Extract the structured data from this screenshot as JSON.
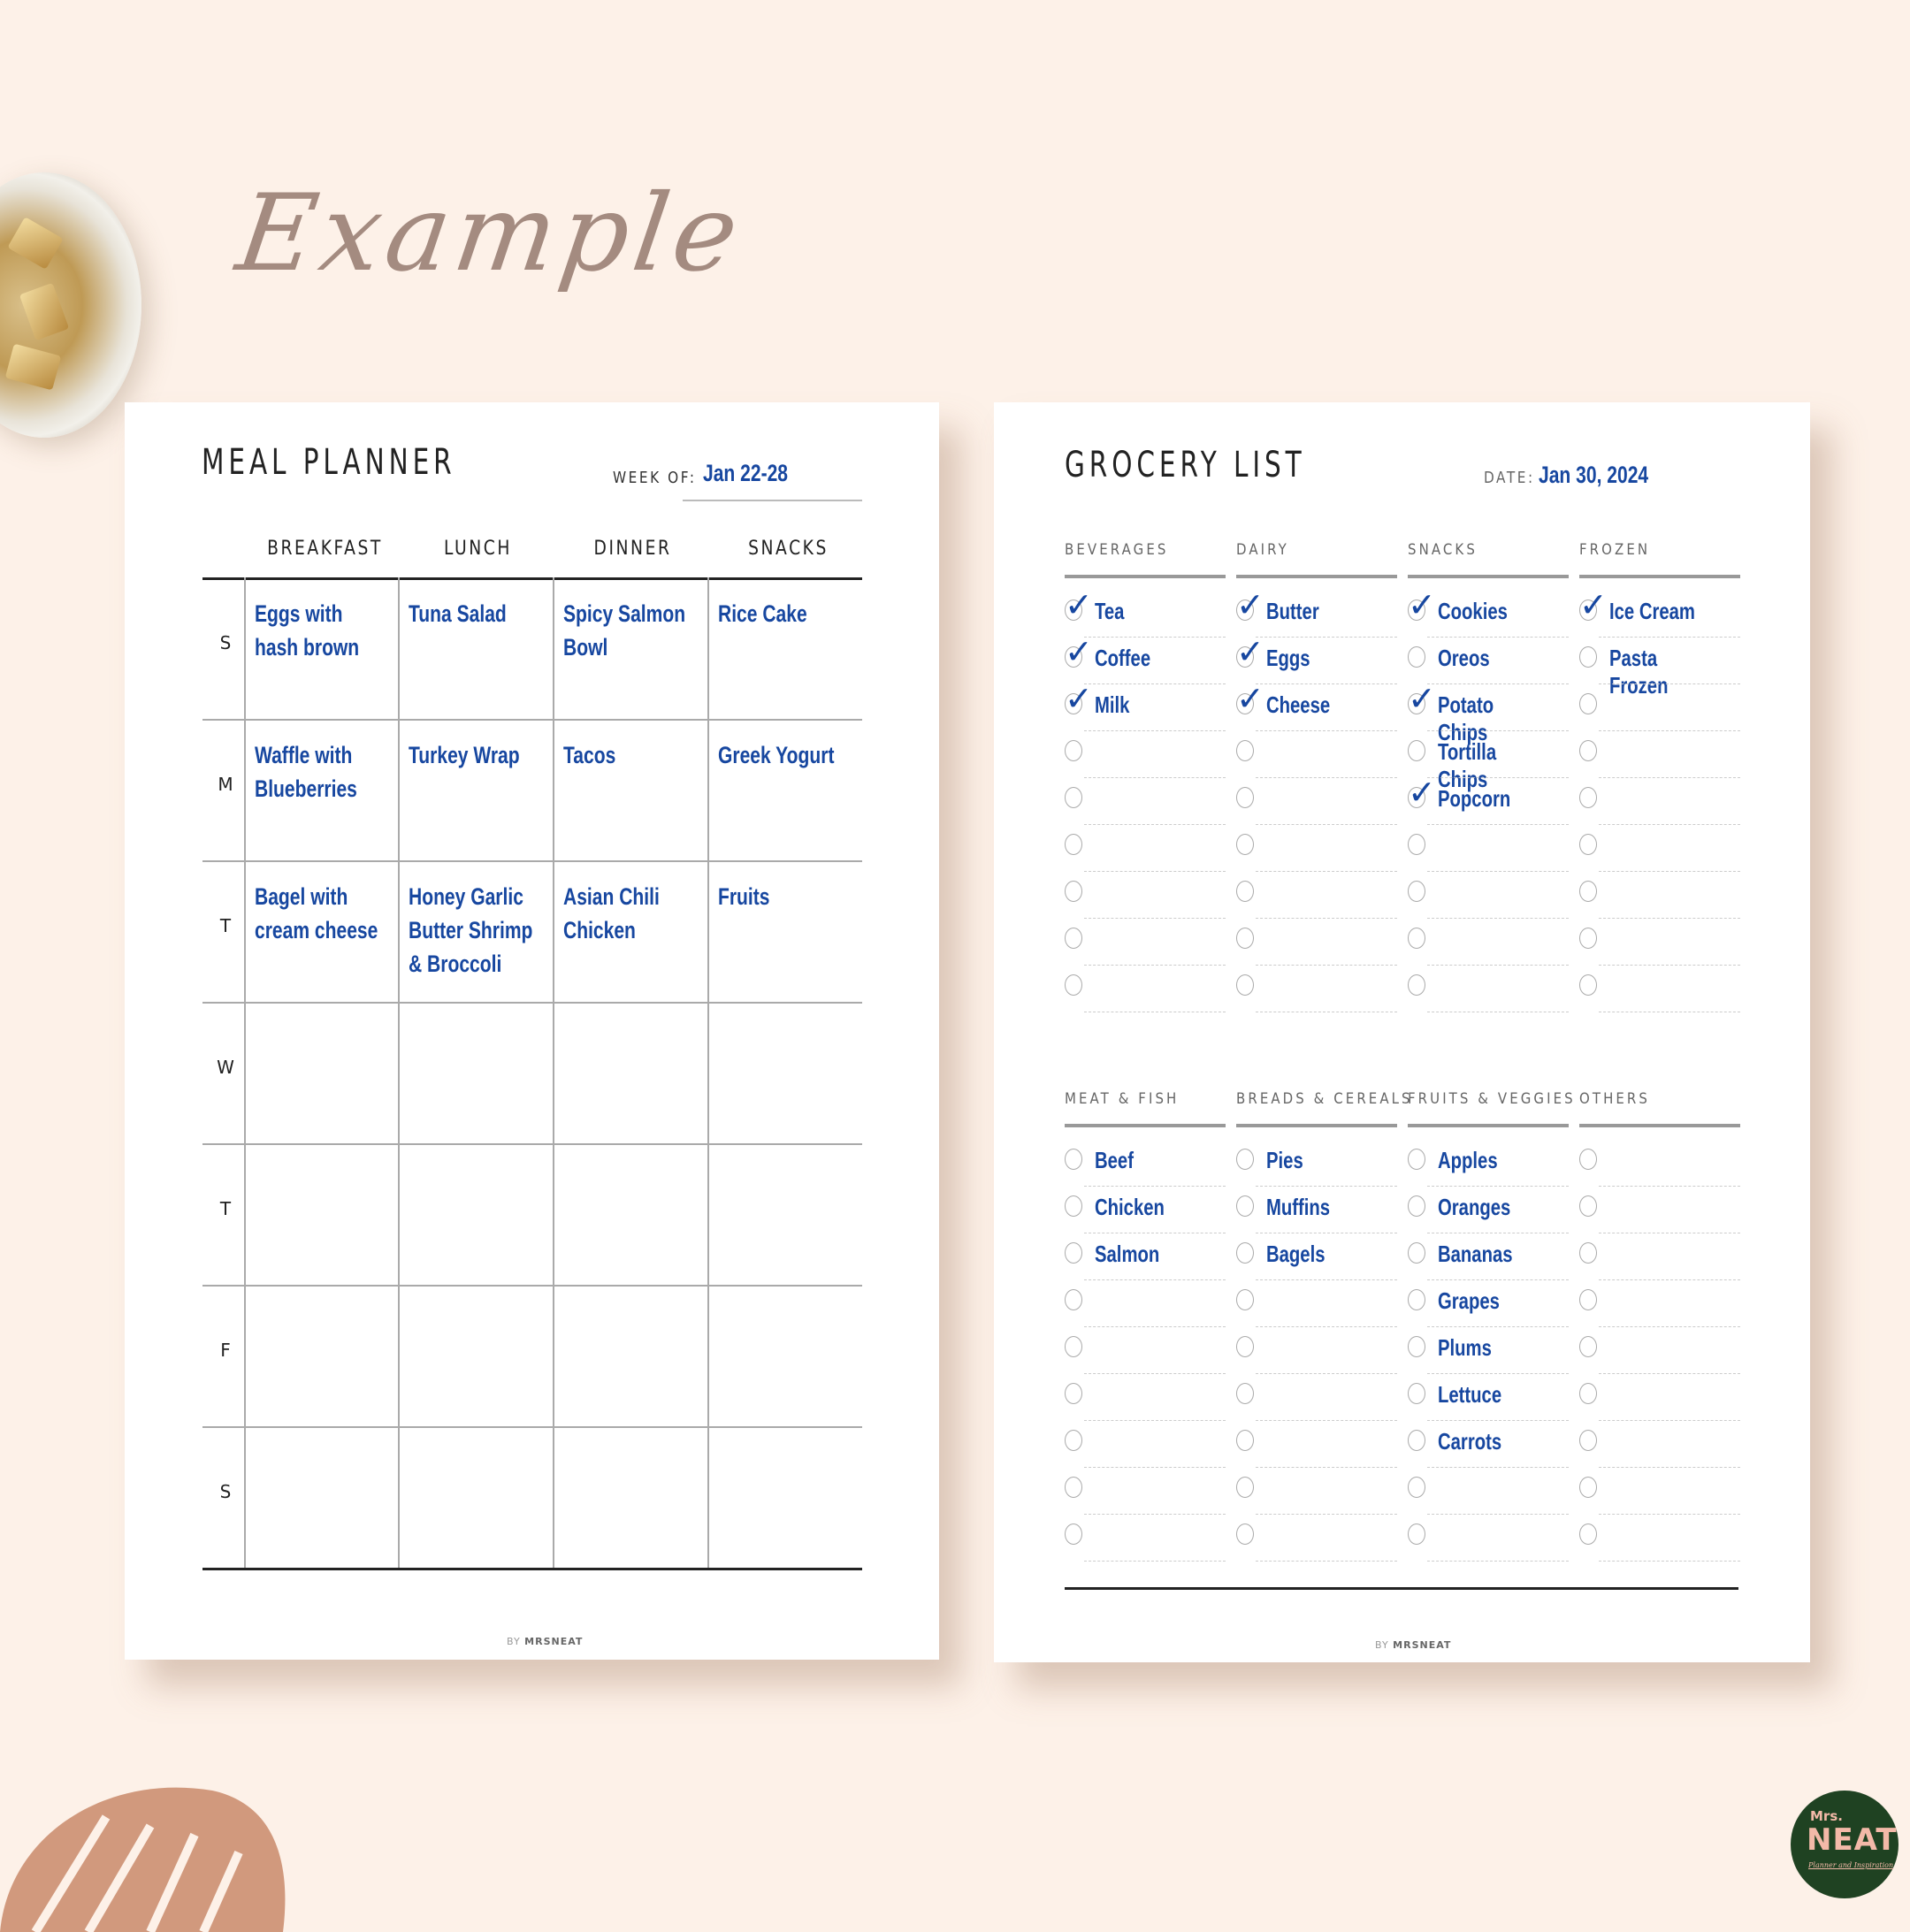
{
  "heading": "Example",
  "meal_planner": {
    "title": "MEAL PLANNER",
    "week_label": "WEEK OF:",
    "week_value": "Jan 22-28",
    "columns": [
      "BREAKFAST",
      "LUNCH",
      "DINNER",
      "SNACKS"
    ],
    "rows": [
      {
        "day": "S",
        "cells": [
          [
            "Eggs with",
            "hash brown"
          ],
          [
            "Tuna Salad"
          ],
          [
            "Spicy Salmon",
            "Bowl"
          ],
          [
            "Rice Cake"
          ]
        ]
      },
      {
        "day": "M",
        "cells": [
          [
            "Waffle with",
            "Blueberries"
          ],
          [
            "Turkey Wrap"
          ],
          [
            "Tacos"
          ],
          [
            "Greek Yogurt"
          ]
        ]
      },
      {
        "day": "T",
        "cells": [
          [
            "Bagel with",
            "cream cheese"
          ],
          [
            "Honey Garlic",
            "Butter Shrimp",
            "& Broccoli"
          ],
          [
            "Asian Chili",
            "Chicken"
          ],
          [
            "Fruits"
          ]
        ]
      },
      {
        "day": "W",
        "cells": [
          [],
          [],
          [],
          []
        ]
      },
      {
        "day": "T",
        "cells": [
          [],
          [],
          [],
          []
        ]
      },
      {
        "day": "F",
        "cells": [
          [],
          [],
          [],
          []
        ]
      },
      {
        "day": "S",
        "cells": [
          [],
          [],
          [],
          []
        ]
      }
    ],
    "footer_by": "BY",
    "footer_brand": "MRSNEAT"
  },
  "grocery_list": {
    "title": "GROCERY LIST",
    "date_label": "DATE:",
    "date_value": "Jan 30, 2024",
    "sections_top": [
      {
        "name": "BEVERAGES",
        "items": [
          {
            "text": "Tea",
            "checked": true
          },
          {
            "text": "Coffee",
            "checked": true
          },
          {
            "text": "Milk",
            "checked": true
          },
          {
            "text": "",
            "checked": false
          },
          {
            "text": "",
            "checked": false
          },
          {
            "text": "",
            "checked": false
          },
          {
            "text": "",
            "checked": false
          },
          {
            "text": "",
            "checked": false
          },
          {
            "text": "",
            "checked": false
          }
        ]
      },
      {
        "name": "DAIRY",
        "items": [
          {
            "text": "Butter",
            "checked": true
          },
          {
            "text": "Eggs",
            "checked": true
          },
          {
            "text": "Cheese",
            "checked": true
          },
          {
            "text": "",
            "checked": false
          },
          {
            "text": "",
            "checked": false
          },
          {
            "text": "",
            "checked": false
          },
          {
            "text": "",
            "checked": false
          },
          {
            "text": "",
            "checked": false
          },
          {
            "text": "",
            "checked": false
          }
        ]
      },
      {
        "name": "SNACKS",
        "items": [
          {
            "text": "Cookies",
            "checked": true
          },
          {
            "text": "Oreos",
            "checked": false
          },
          {
            "text": "Potato Chips",
            "checked": true
          },
          {
            "text": "Tortilla Chips",
            "checked": false
          },
          {
            "text": "Popcorn",
            "checked": true
          },
          {
            "text": "",
            "checked": false
          },
          {
            "text": "",
            "checked": false
          },
          {
            "text": "",
            "checked": false
          },
          {
            "text": "",
            "checked": false
          }
        ]
      },
      {
        "name": "FROZEN",
        "items": [
          {
            "text": "Ice Cream",
            "checked": true
          },
          {
            "text": "Pasta Frozen",
            "checked": false
          },
          {
            "text": "",
            "checked": false
          },
          {
            "text": "",
            "checked": false
          },
          {
            "text": "",
            "checked": false
          },
          {
            "text": "",
            "checked": false
          },
          {
            "text": "",
            "checked": false
          },
          {
            "text": "",
            "checked": false
          },
          {
            "text": "",
            "checked": false
          }
        ]
      }
    ],
    "sections_bottom": [
      {
        "name": "MEAT & FISH",
        "items": [
          {
            "text": "Beef",
            "checked": false
          },
          {
            "text": "Chicken",
            "checked": false
          },
          {
            "text": "Salmon",
            "checked": false
          },
          {
            "text": "",
            "checked": false
          },
          {
            "text": "",
            "checked": false
          },
          {
            "text": "",
            "checked": false
          },
          {
            "text": "",
            "checked": false
          },
          {
            "text": "",
            "checked": false
          },
          {
            "text": "",
            "checked": false
          }
        ]
      },
      {
        "name": "BREADS & CEREALS",
        "items": [
          {
            "text": "Pies",
            "checked": false
          },
          {
            "text": "Muffins",
            "checked": false
          },
          {
            "text": "Bagels",
            "checked": false
          },
          {
            "text": "",
            "checked": false
          },
          {
            "text": "",
            "checked": false
          },
          {
            "text": "",
            "checked": false
          },
          {
            "text": "",
            "checked": false
          },
          {
            "text": "",
            "checked": false
          },
          {
            "text": "",
            "checked": false
          }
        ]
      },
      {
        "name": "FRUITS & VEGGIES",
        "items": [
          {
            "text": "Apples",
            "checked": false
          },
          {
            "text": "Oranges",
            "checked": false
          },
          {
            "text": "Bananas",
            "checked": false
          },
          {
            "text": "Grapes",
            "checked": false
          },
          {
            "text": "Plums",
            "checked": false
          },
          {
            "text": "Lettuce",
            "checked": false
          },
          {
            "text": "Carrots",
            "checked": false
          },
          {
            "text": "",
            "checked": false
          },
          {
            "text": "",
            "checked": false
          }
        ]
      },
      {
        "name": "OTHERS",
        "items": [
          {
            "text": "",
            "checked": false
          },
          {
            "text": "",
            "checked": false
          },
          {
            "text": "",
            "checked": false
          },
          {
            "text": "",
            "checked": false
          },
          {
            "text": "",
            "checked": false
          },
          {
            "text": "",
            "checked": false
          },
          {
            "text": "",
            "checked": false
          },
          {
            "text": "",
            "checked": false
          },
          {
            "text": "",
            "checked": false
          }
        ]
      }
    ],
    "footer_by": "BY",
    "footer_brand": "MRSNEAT"
  },
  "logo": {
    "line1": "Mrs.",
    "line2": "NEAT",
    "tagline": "Planner and Inspiration"
  },
  "colors": {
    "ink_blue": "#1747a0",
    "background": "#fdf1e8",
    "logo_green": "#1f4222",
    "logo_pink": "#f3b9a8",
    "heading": "#a48b80"
  }
}
